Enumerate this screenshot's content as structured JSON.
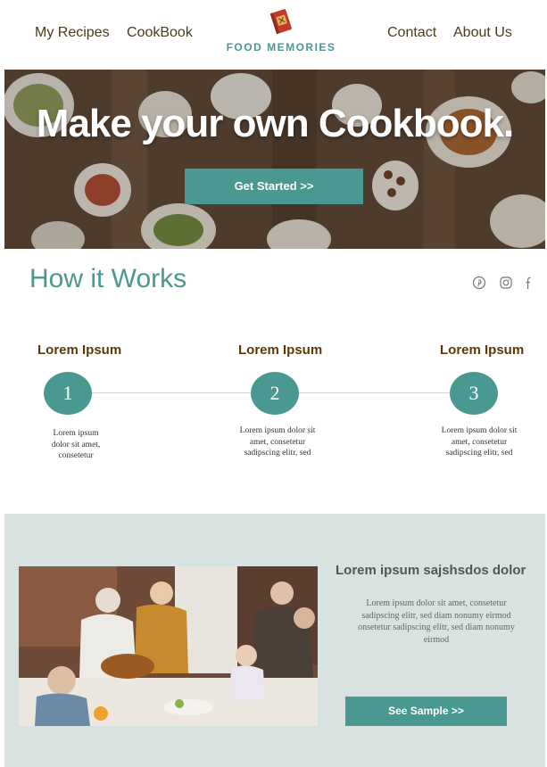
{
  "header": {
    "nav_left": [
      "My Recipes",
      "CookBook"
    ],
    "logo_text": "FOOD MEMORIES",
    "nav_right": [
      "Contact",
      "About Us"
    ]
  },
  "hero": {
    "title": "Make your  own Cookbook.",
    "button_label": "Get Started >>"
  },
  "how_it_works": {
    "title": "How it Works",
    "social_icons": [
      "pinterest-icon",
      "instagram-icon",
      "facebook-icon"
    ],
    "steps": [
      {
        "heading": "Lorem Ipsum",
        "number": "1",
        "text": "Lorem ipsum dolor sit amet, consetetur"
      },
      {
        "heading": "Lorem Ipsum",
        "number": "2",
        "text": "Lorem ipsum dolor sit amet, consetetur sadipscing elitr, sed"
      },
      {
        "heading": "Lorem Ipsum",
        "number": "3",
        "text": "Lorem ipsum dolor sit amet, consetetur sadipscing elitr, sed"
      }
    ]
  },
  "sample": {
    "heading": "Lorem ipsum sajshsdos dolor",
    "text": "Lorem ipsum dolor sit amet, consetetur sadipscing elitr, sed diam nonumy eirmod onsetetur sadipscing elitr, sed diam nonumy eirmod",
    "button_label": "See Sample >>"
  },
  "colors": {
    "accent": "#4a9892",
    "nav_text": "#4a3b1d",
    "step_heading": "#5a3a08",
    "sample_background": "#d8e3e1"
  }
}
